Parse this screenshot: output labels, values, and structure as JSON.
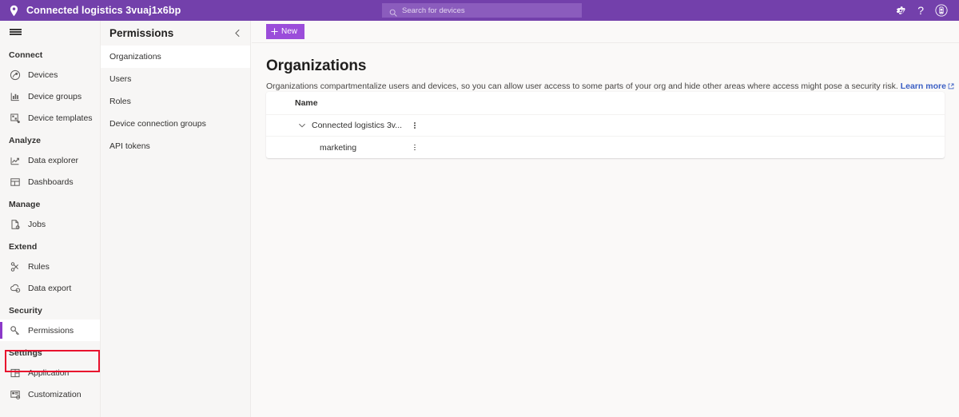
{
  "header": {
    "title": "Connected logistics 3vuaj1x6bp",
    "location_icon": "location-pin-icon",
    "search": {
      "placeholder": "Search for devices",
      "icon": "search-icon"
    },
    "actions": [
      {
        "name": "settings-icon",
        "glyph": "gear"
      },
      {
        "name": "help-icon",
        "glyph": "?"
      },
      {
        "name": "account-icon",
        "glyph": "person"
      }
    ],
    "background_color": "#7340ab",
    "search_background_color": "#8b5cbd"
  },
  "left_nav": {
    "menu_icon": "hamburger-icon",
    "groups": [
      {
        "label": "Connect",
        "items": [
          {
            "label": "Devices",
            "icon": "devices-icon",
            "selected": false
          },
          {
            "label": "Device groups",
            "icon": "device-groups-icon",
            "selected": false
          },
          {
            "label": "Device templates",
            "icon": "device-templates-icon",
            "selected": false
          }
        ]
      },
      {
        "label": "Analyze",
        "items": [
          {
            "label": "Data explorer",
            "icon": "data-explorer-icon",
            "selected": false
          },
          {
            "label": "Dashboards",
            "icon": "dashboards-icon",
            "selected": false
          }
        ]
      },
      {
        "label": "Manage",
        "items": [
          {
            "label": "Jobs",
            "icon": "jobs-icon",
            "selected": false
          }
        ]
      },
      {
        "label": "Extend",
        "items": [
          {
            "label": "Rules",
            "icon": "rules-icon",
            "selected": false
          },
          {
            "label": "Data export",
            "icon": "data-export-icon",
            "selected": false
          }
        ]
      },
      {
        "label": "Security",
        "items": [
          {
            "label": "Permissions",
            "icon": "permissions-key-icon",
            "selected": true
          }
        ]
      },
      {
        "label": "Settings",
        "items": [
          {
            "label": "Application",
            "icon": "application-icon",
            "selected": false
          },
          {
            "label": "Customization",
            "icon": "customization-icon",
            "selected": false
          }
        ]
      }
    ],
    "highlight_color": "#e8112d",
    "selected_accent_color": "#8c39c9"
  },
  "sub_nav": {
    "title": "Permissions",
    "collapse_icon": "chevron-left-icon",
    "items": [
      {
        "label": "Organizations",
        "selected": true
      },
      {
        "label": "Users",
        "selected": false
      },
      {
        "label": "Roles",
        "selected": false
      },
      {
        "label": "Device connection groups",
        "selected": false
      },
      {
        "label": "API tokens",
        "selected": false
      }
    ]
  },
  "main": {
    "new_button": {
      "label": "New",
      "icon": "plus-icon",
      "color": "#9b4dda"
    },
    "heading": "Organizations",
    "description": "Organizations compartmentalize users and devices, so you can allow user access to some parts of your org and hide other areas where access might pose a security risk.",
    "learn_more": {
      "label": "Learn more",
      "icon": "external-link-icon",
      "color": "#3b5fc4"
    },
    "table": {
      "columns": [
        "Name"
      ],
      "rows": [
        {
          "name": "Connected logistics 3v...",
          "level": 0,
          "expanded": true,
          "chevron": "chevron-down-icon",
          "menu": "more-options-icon"
        },
        {
          "name": "marketing",
          "level": 1,
          "expanded": false,
          "chevron": "",
          "menu": "more-options-icon"
        }
      ]
    }
  }
}
